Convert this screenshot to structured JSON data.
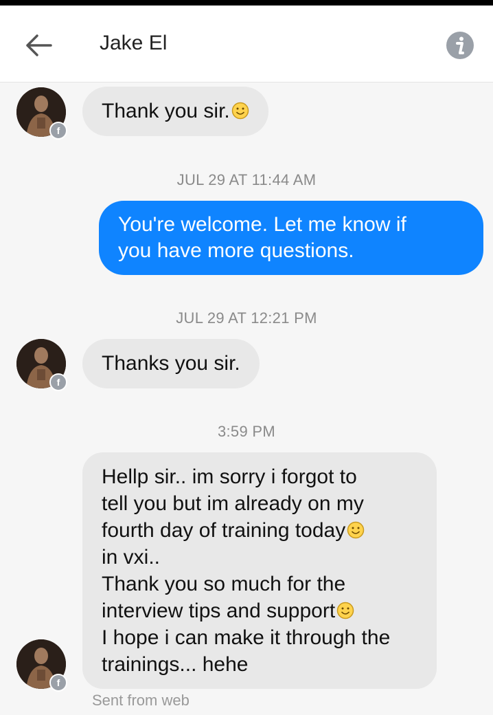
{
  "header": {
    "title": "Jake El",
    "back_icon": "arrow-left-icon",
    "info_icon": "info-icon"
  },
  "messages": {
    "m1": {
      "text": "Thank you sir."
    },
    "ts1": "JUL 29 AT 11:44 AM",
    "m2": {
      "line1": "You're welcome. Let me know if",
      "line2": "you have more questions."
    },
    "ts2": "JUL 29 AT 12:21 PM",
    "m3": {
      "text": "Thanks you sir."
    },
    "ts3": "3:59 PM",
    "m4": {
      "l1": "Hellp sir.. im sorry i forgot to",
      "l2": "tell you but im already on my",
      "l3": "fourth day of training today",
      "l4": "in vxi..",
      "l5": "Thank you so much for the",
      "l6": "interview tips and support",
      "l7": "I hope i can make it through the",
      "l8": "trainings... hehe"
    },
    "sent_from": "Sent from web"
  },
  "colors": {
    "outgoing_bubble": "#0f84ff",
    "incoming_bubble": "#e8e8e8",
    "background": "#f6f6f6"
  }
}
